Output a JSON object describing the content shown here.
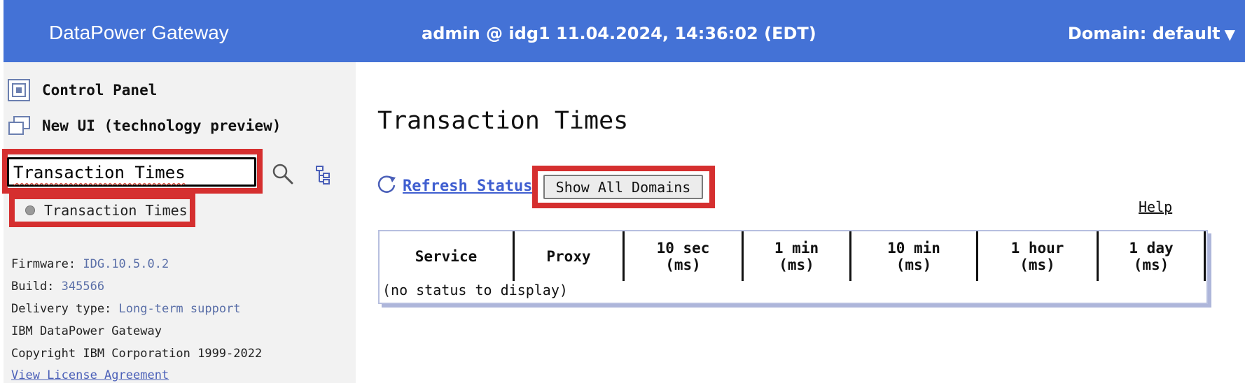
{
  "header": {
    "brand": "DataPower Gateway",
    "session": "admin @ idg1 11.04.2024, 14:36:02 (EDT)",
    "domain_label": "Domain: default",
    "domain_caret": "▼",
    "background": "#4472d6"
  },
  "sidebar": {
    "nav": [
      {
        "label": "Control Panel",
        "icon": "control-panel-icon"
      },
      {
        "label": "New UI (technology preview)",
        "icon": "new-window-icon"
      }
    ],
    "search": {
      "value": "Transaction Times"
    },
    "results": [
      {
        "label": "Transaction Times"
      }
    ],
    "info": {
      "firmware_label": "Firmware:",
      "firmware_value": "IDG.10.5.0.2",
      "build_label": "Build:",
      "build_value": "345566",
      "delivery_label": "Delivery type:",
      "delivery_value": "Long-term support",
      "product": "IBM DataPower Gateway",
      "copyright": "Copyright IBM Corporation 1999-2022",
      "license_link": "View License Agreement"
    }
  },
  "main": {
    "title": "Transaction Times",
    "refresh_label": "Refresh Status",
    "show_all_label": "Show All Domains",
    "help_label": "Help",
    "table": {
      "columns": [
        "Service",
        "Proxy",
        "10 sec (ms)",
        "1 min (ms)",
        "10 min (ms)",
        "1 hour (ms)",
        "1 day (ms)"
      ],
      "column_lines": [
        [
          "Service"
        ],
        [
          "Proxy"
        ],
        [
          "10 sec",
          "(ms)"
        ],
        [
          "1 min",
          "(ms)"
        ],
        [
          "10 min",
          "(ms)"
        ],
        [
          "1 hour",
          "(ms)"
        ],
        [
          "1 day",
          "(ms)"
        ]
      ],
      "empty_message": "(no status to display)"
    }
  },
  "colors": {
    "highlight": "#d52f2f",
    "link": "#3f5ed0",
    "sidebar_bg": "#f2f2f2"
  }
}
